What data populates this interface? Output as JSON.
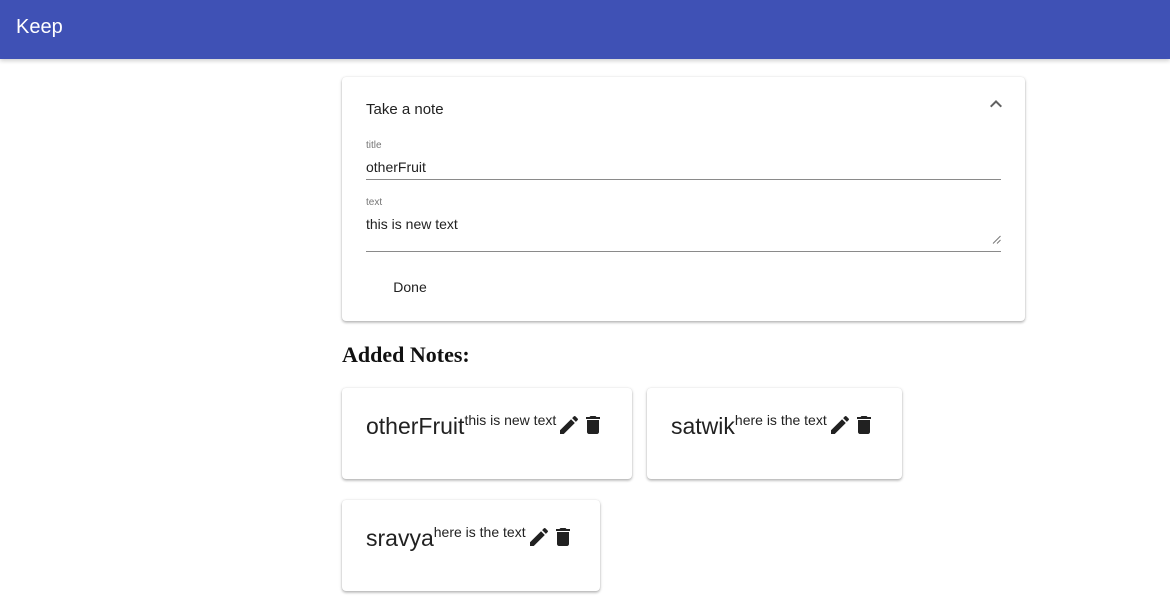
{
  "app": {
    "title": "Keep"
  },
  "form": {
    "header": "Take a note",
    "collapse_icon": "chevron-up-icon",
    "title_label": "title",
    "title_value": "otherFruit",
    "text_label": "text",
    "text_value": "this is new text",
    "done_label": "Done"
  },
  "notes_section": {
    "heading": "Added Notes:"
  },
  "notes": [
    {
      "title": "otherFruit",
      "text": "this is new text",
      "edit_icon": "pencil-icon",
      "delete_icon": "trash-icon"
    },
    {
      "title": "satwik",
      "text": "here is the text",
      "edit_icon": "pencil-icon",
      "delete_icon": "trash-icon"
    },
    {
      "title": "sravya",
      "text": "here is the text",
      "edit_icon": "pencil-icon",
      "delete_icon": "trash-icon"
    }
  ],
  "colors": {
    "appbar": "#3f51b5",
    "appbar_text": "#ffffff",
    "text": "#212121",
    "label": "#757575"
  }
}
